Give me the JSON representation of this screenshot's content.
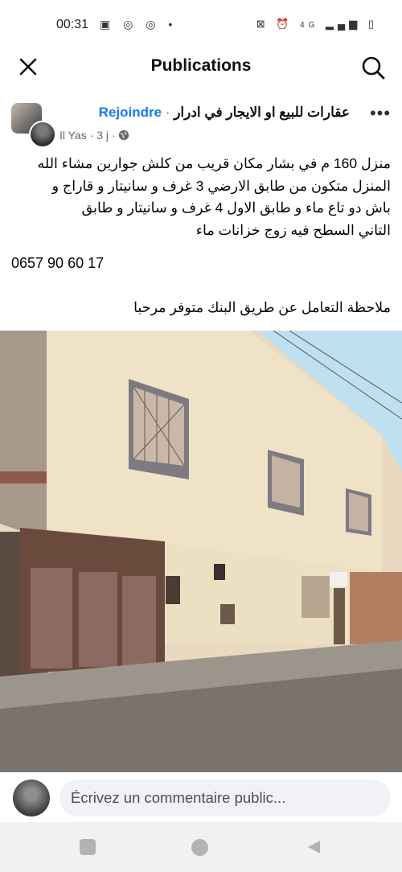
{
  "status_bar": {
    "time": "00:31",
    "icons_left": [
      "image-icon",
      "instagram-icon",
      "instagram-icon",
      "dot-icon"
    ],
    "signal_label": "4G"
  },
  "header": {
    "title": "Publications",
    "close_icon": "close-icon",
    "search_icon": "search-icon"
  },
  "post": {
    "group_name": "عقارات للبيع او الايجار في ادرار",
    "separator": "·",
    "join_label": "Rejoindre",
    "author": "Il Yas",
    "time_ago": "3 j",
    "more_label": "•••",
    "text_lines": [
      "منزل 160 م في بشار مكان قريب من كلش جوارين مشاء الله",
      "المنزل متكون من طابق الارضي  3 غرف و سانيتار و  قاراج و",
      "باش دو تاع ماء و طابق الاول 4 غرف  و سانيتار و طابق",
      "التاني السطح فيه زوج خزانات ماء"
    ],
    "phone": "0657 90 60 17",
    "note": "ملاحظة التعامل عن طريق البنك متوفر  مرحبا"
  },
  "comment": {
    "placeholder": "Écrivez un commentaire public..."
  },
  "colors": {
    "link_blue": "#1877f2",
    "secondary_text": "#65676b",
    "input_bg": "#f0f2f5"
  }
}
